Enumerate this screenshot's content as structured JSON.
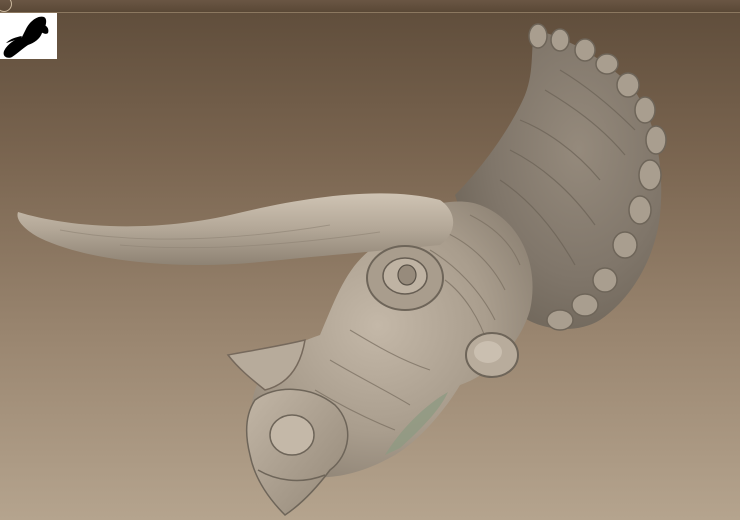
{
  "viewport": {
    "background_top": "#5e4c3a",
    "background_bottom": "#b5a48e",
    "sculpt_color": "#b3a797"
  },
  "navigator": {
    "icon": "silhouette-thumbnail-icon",
    "background": "#ffffff",
    "silhouette_color": "#000000"
  }
}
